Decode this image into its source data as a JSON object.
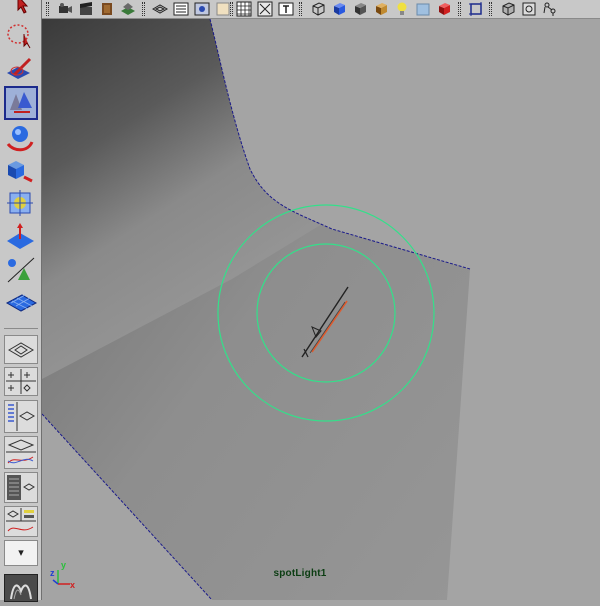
{
  "toolbar_top": {
    "icons": [
      "select-arrow-icon",
      "camera-icon",
      "movie-clapper-icon",
      "render-icon",
      "batch-render-icon",
      "wireframe-shading-icon",
      "smooth-shading-icon",
      "textured-icon",
      "grid-icon",
      "isolate-icon",
      "text-icon",
      "wire-cube-icon",
      "blue-cube-icon",
      "shaded-cube-icon",
      "textured-cube-icon",
      "light-bulb-icon",
      "transparent-cube-icon",
      "red-cube-icon",
      "frame-icon",
      "xray-cube-icon",
      "cube-joint-icon",
      "skeleton-icon"
    ]
  },
  "toolbox": {
    "tools": [
      "select-tool-icon",
      "lasso-tool-icon",
      "paint-select-tool-icon",
      "move-tool-icon",
      "rotate-tool-icon",
      "scale-tool-icon",
      "universal-manipulator-icon",
      "soft-modification-icon",
      "show-manipulator-icon",
      "last-tool-icon"
    ],
    "selected_tool": "move-tool-icon",
    "layouts": [
      "single-perspective-layout-icon",
      "four-view-layout-icon",
      "persp-outliner-layout-icon",
      "persp-graph-layout-icon",
      "hypershade-layout-icon",
      "persp-trax-layout-icon"
    ],
    "dropdown_glyph": "▾",
    "bottom_icon": "maya-logo-icon"
  },
  "viewport": {
    "camera_label": "spotLight1",
    "axes": {
      "x": "x",
      "y": "y",
      "z": "z"
    },
    "colors": {
      "background": "#a4a4a4",
      "surface": "#9a9a9a",
      "edge": "#1a1a8a",
      "light_manipulator": "#33e08a",
      "highlight": "#e05a2c"
    }
  }
}
